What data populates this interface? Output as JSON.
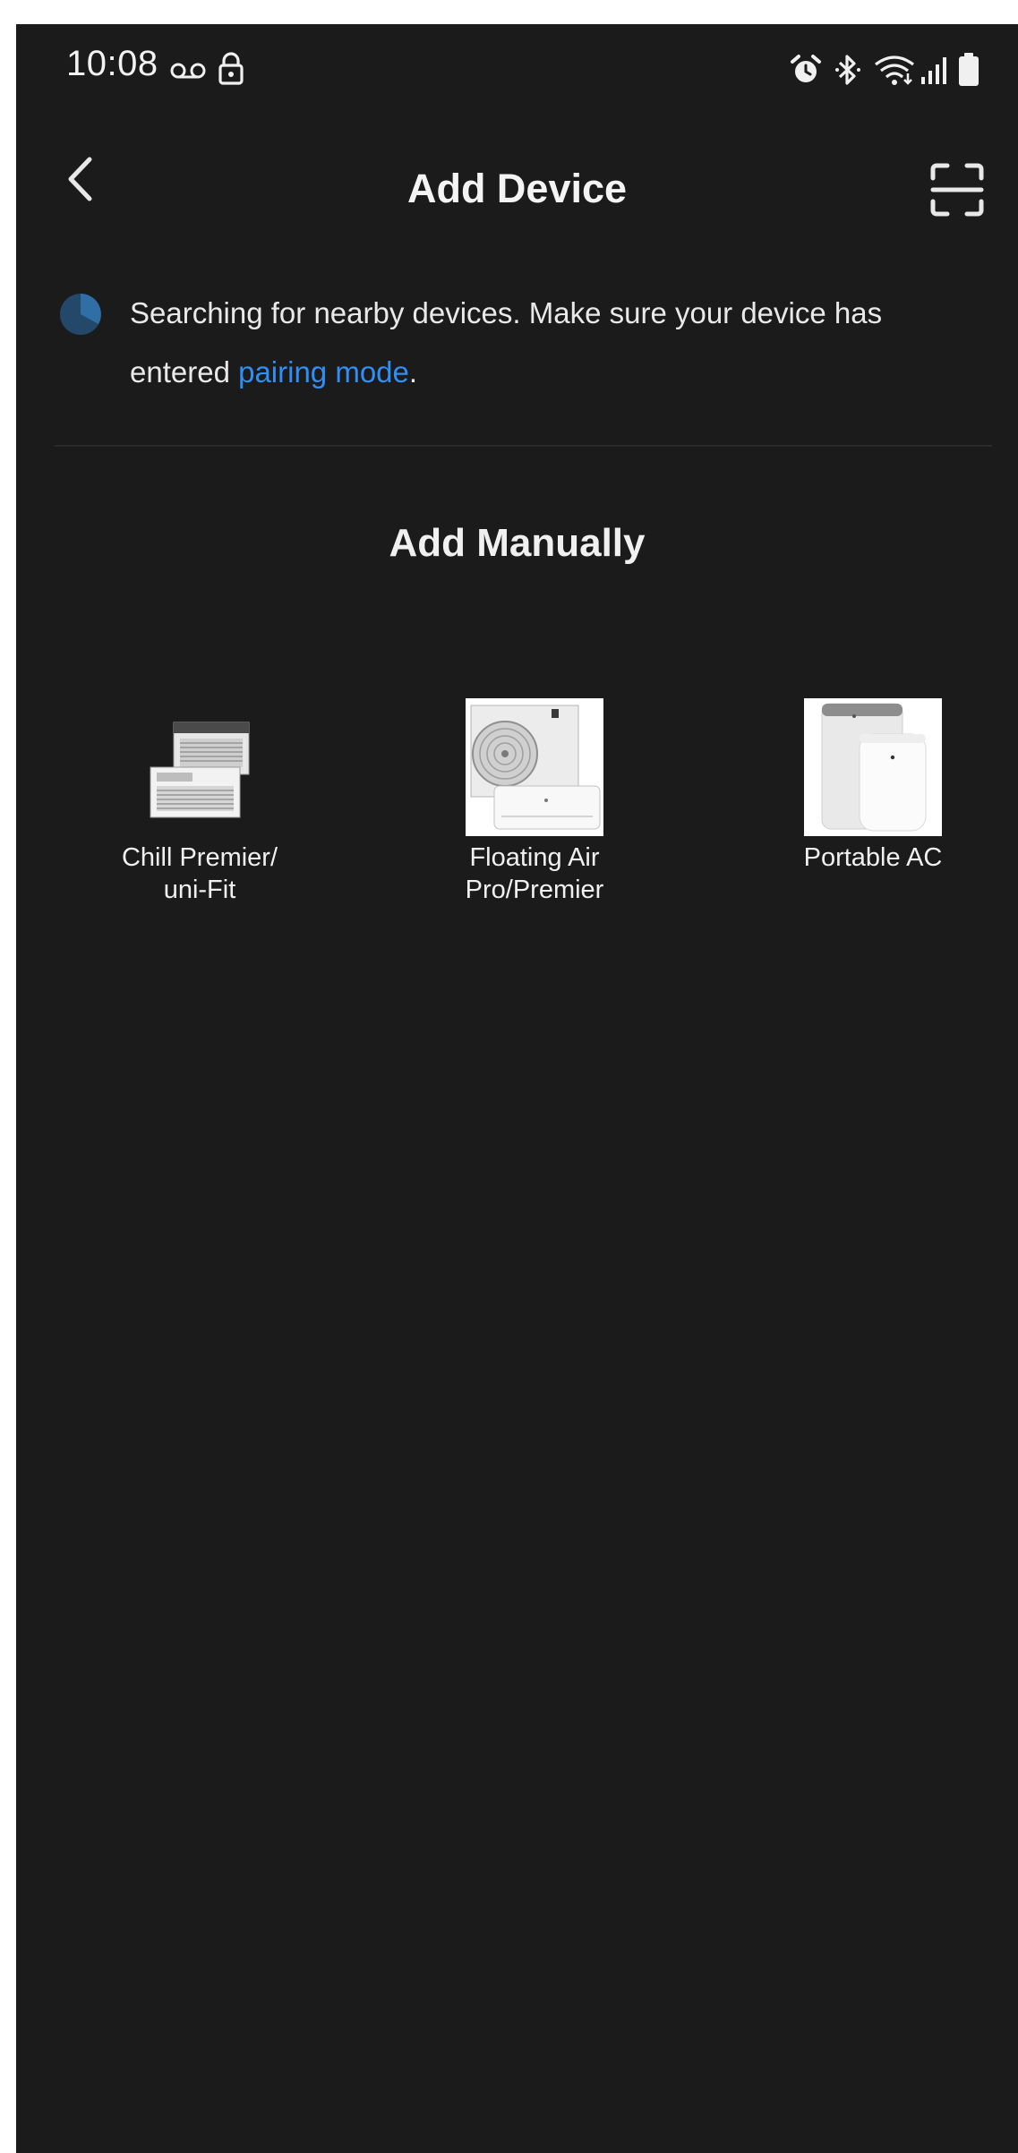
{
  "status_bar": {
    "time": "10:08",
    "icons": [
      "voicemail-icon",
      "lock-icon",
      "alarm-icon",
      "bluetooth-icon",
      "wifi-icon",
      "signal-icon",
      "battery-icon"
    ]
  },
  "header": {
    "title": "Add Device",
    "back_icon": "chevron-left-icon",
    "scan_icon": "scan-icon"
  },
  "search_notice": {
    "text_before": "Searching for nearby devices. Make sure your device has entered ",
    "link_text": "pairing mode",
    "text_after": "."
  },
  "manual": {
    "title": "Add Manually",
    "devices": [
      {
        "label": "Chill Premier/\nuni-Fit",
        "icon": "window-ac-image"
      },
      {
        "label": "Floating Air\nPro/Premier",
        "icon": "mini-split-image"
      },
      {
        "label": "Portable AC",
        "icon": "portable-ac-image"
      }
    ]
  },
  "colors": {
    "background": "#1b1b1b",
    "link": "#2f8ff5",
    "text": "#ededed"
  }
}
